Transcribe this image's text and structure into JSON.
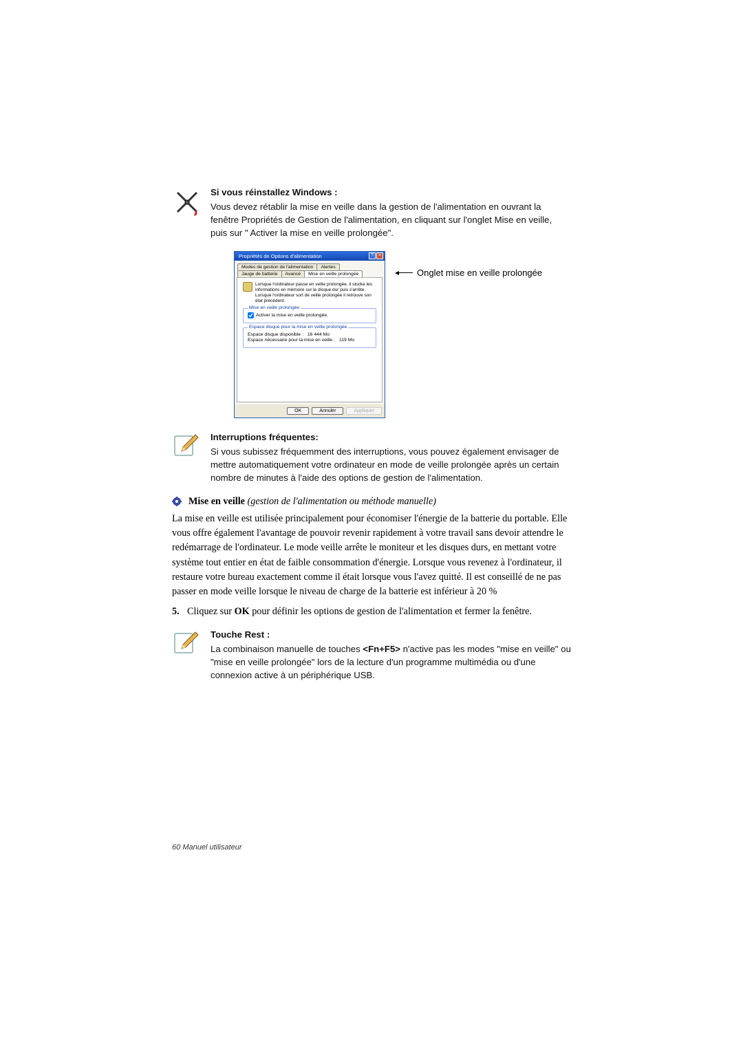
{
  "note1": {
    "heading": "Si vous réinstallez Windows :",
    "body": "Vous devez rétablir la mise en veille dans la gestion de l'alimentation en ouvrant la fenêtre Propriétés de Gestion de l'alimentation, en cliquant sur l'onglet Mise en veille, puis sur \" Activer la mise en veille prolongée\"."
  },
  "dialog": {
    "title": "Propriétés de Options d'alimentation",
    "tabs": {
      "t1": "Modes de gestion de l'alimentation",
      "t2": "Alertes",
      "t3": "Jauge de batterie",
      "t4": "Avancé",
      "t5": "Mise en veille prolongée"
    },
    "info": "Lorsque l'ordinateur passe en veille prolongée, il stocke les informations en mémoire sur le disque dur puis s'arrête. Lorsque l'ordinateur sort de veille prolongée il retrouve son état précédent.",
    "group1": {
      "label": "Mise en veille prolongée",
      "checkbox": "Activer la mise en veille prolongée."
    },
    "group2": {
      "label": "Espace disque pour la mise en veille prolongée",
      "line1_k": "Espace disque disponible :",
      "line1_v": "16 444 Mo",
      "line2_k": "Espace nécessaire pour la mise en veille :",
      "line2_v": "119 Mo"
    },
    "buttons": {
      "ok": "OK",
      "cancel": "Annuler",
      "apply": "Appliquer"
    }
  },
  "callout": "Onglet mise en veille prolongée",
  "note2": {
    "heading": "Interruptions fréquentes:",
    "body": "Si vous subissez fréquemment des interruptions, vous pouvez également envisager de mettre automatiquement votre ordinateur en mode de veille prolongée après un certain nombre de minutes à l'aide des options de gestion de l'alimentation."
  },
  "section": {
    "title_bold": "Mise en veille",
    "title_italic": "(gestion de l'alimentation ou méthode manuelle)",
    "body": "La mise en veille est utilisée principalement pour économiser l'énergie de la batterie du portable. Elle vous offre également l'avantage de pouvoir revenir rapidement à votre travail sans devoir attendre le redémarrage de l'ordinateur. Le mode veille arrête le moniteur et les disques durs, en mettant votre système tout entier en état de faible consommation d'énergie. Lorsque vous revenez à l'ordinateur, il restaure votre bureau exactement comme il était lorsque vous l'avez quitté. Il est conseillé de ne pas passer en mode veille lorsque le niveau de charge de la batterie est inférieur à 20 %"
  },
  "step5": {
    "num": "5.",
    "text_pre": "Cliquez sur ",
    "text_bold": "OK",
    "text_post": " pour définir les options de gestion de l'alimentation et fermer la fenêtre."
  },
  "note3": {
    "heading": "Touche Rest :",
    "body_pre": "La combinaison manuelle de touches ",
    "body_bold": "<Fn+F5>",
    "body_post": " n'active pas les modes \"mise en veille\" ou \"mise en veille prolongée\" lors de la lecture d'un programme multimédia ou d'une connexion active à un périphérique USB."
  },
  "footer_page": "60",
  "footer_label": "Manuel utilisateur"
}
